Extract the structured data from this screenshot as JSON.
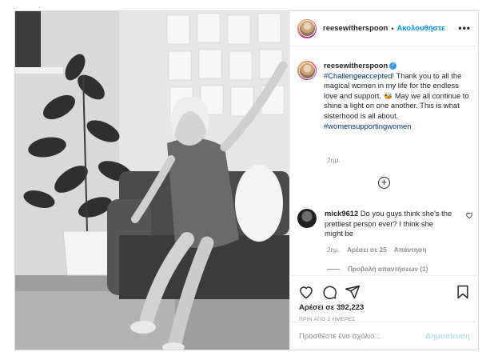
{
  "post": {
    "username": "reesewitherspoon",
    "follow_label": "Ακολουθήστε",
    "more_label": "•••",
    "photo_alt": "photo"
  },
  "caption": {
    "username": "reesewitherspoon",
    "hashtag1": "#Challengeaccepted",
    "text1": "! Thank you to all the magical women in my life for the endless love and support. ",
    "emoji": "🐝",
    "text2": " May we all continue to shine a light on one another. This is what sisterhood is all about. ",
    "hashtag2": "#womensupportingwomen",
    "time_ago": "2ημ."
  },
  "comment": {
    "username": "mick9612",
    "text": "Do you guys think she's the prettiest person ever? I think she might be",
    "time_ago": "2ημ.",
    "likes": "Αρέσει σε 25",
    "reply_label": "Απάντηση",
    "view_replies": "Προβολή απαντήσεων (1)"
  },
  "actions": {
    "likes_text": "Αρέσει σε 392,223",
    "date_text": "ΠΡΙΝ ΑΠΟ 2 ΗΜΕΡΕΣ"
  },
  "add_comment": {
    "placeholder": "Προσθέστε ένα σχόλιο...",
    "post_label": "Δημοσίευση"
  },
  "colors": {
    "accent": "#0095f6",
    "post_disabled": "#b2dffc",
    "hashtag": "#00376b",
    "muted": "#8e8e8e"
  }
}
